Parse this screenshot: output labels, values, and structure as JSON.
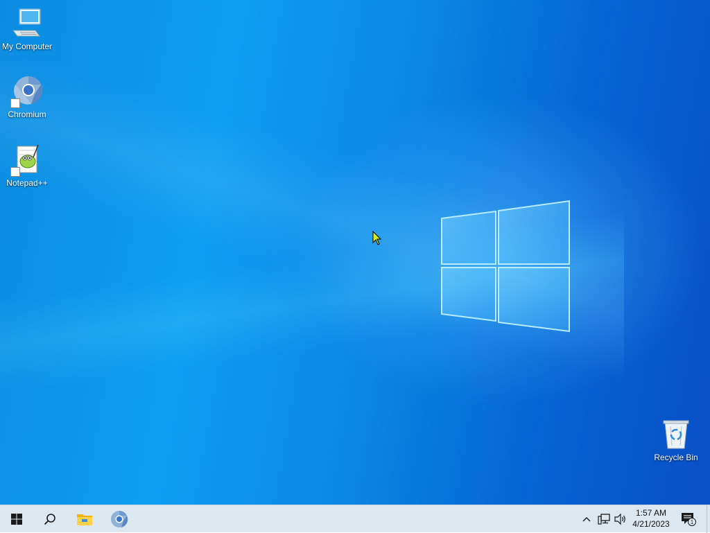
{
  "desktop": {
    "icons": [
      {
        "label": "My Computer",
        "icon": "computer-icon"
      },
      {
        "label": "Chromium",
        "icon": "chromium-icon"
      },
      {
        "label": "Notepad++",
        "icon": "notepad-plus-plus-icon"
      },
      {
        "label": "Recycle Bin",
        "icon": "recycle-bin-icon"
      }
    ]
  },
  "taskbar": {
    "start_icon": "windows-start-icon",
    "search_icon": "search-icon",
    "pinned": [
      {
        "name": "File Explorer",
        "icon": "folder-icon"
      },
      {
        "name": "Chromium",
        "icon": "chromium-icon"
      }
    ],
    "tray": {
      "overflow_icon": "chevron-up-icon",
      "network_icon": "network-icon",
      "volume_icon": "volume-icon",
      "time": "1:57 AM",
      "date": "4/21/2023",
      "notification_icon": "action-center-icon",
      "notification_count": "1"
    }
  },
  "colors": {
    "taskbar_bg": "#dde7f0",
    "desktop_accent": "#0a8be0"
  }
}
